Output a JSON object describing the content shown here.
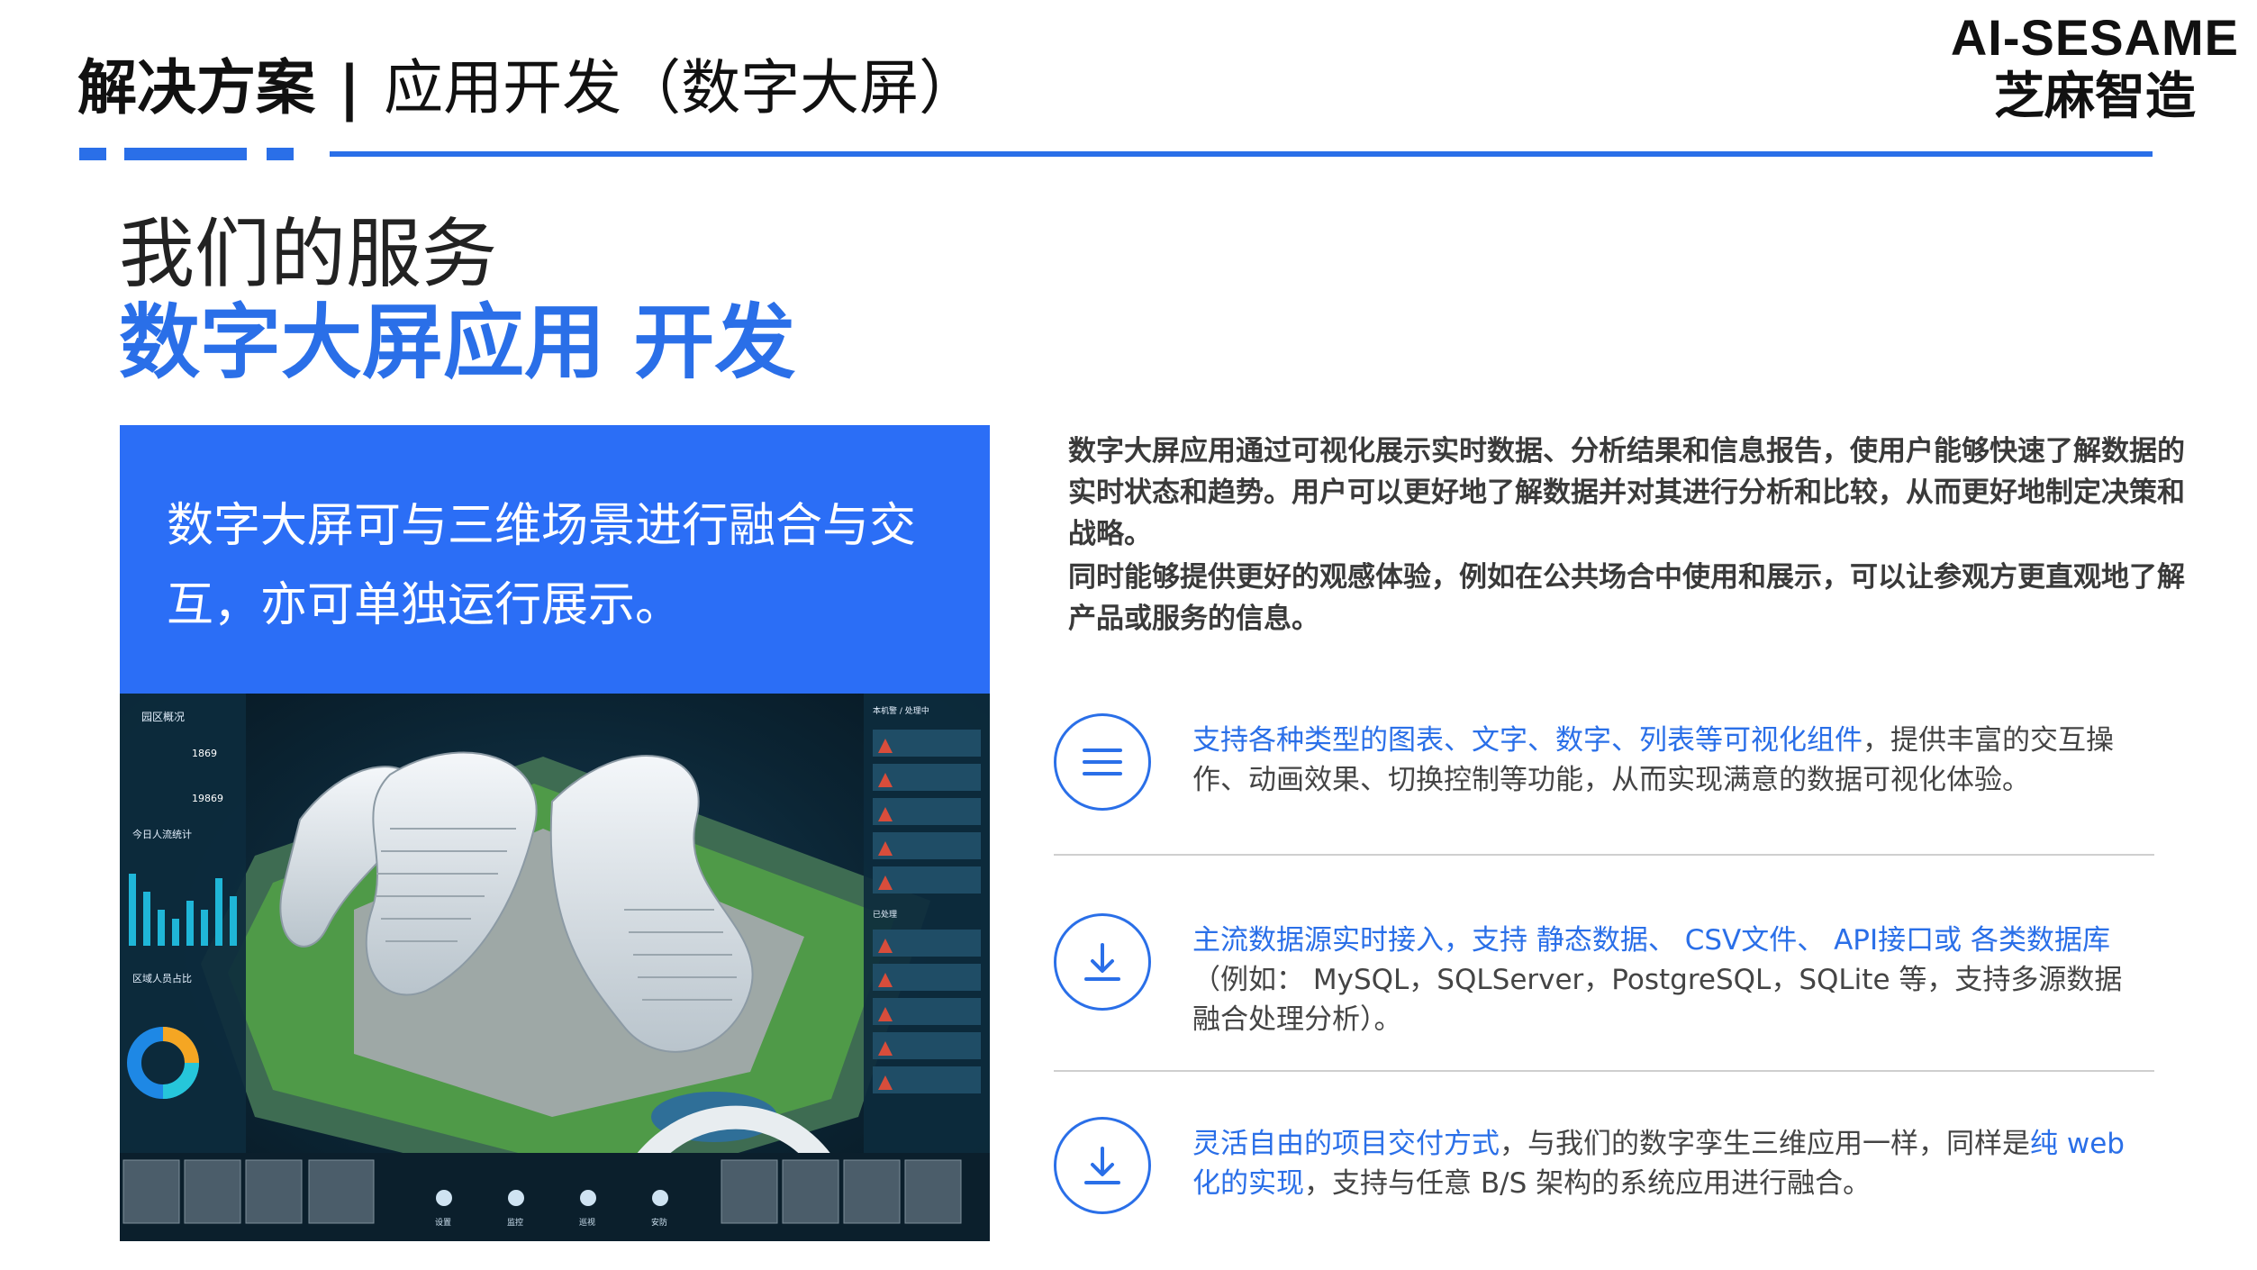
{
  "header": {
    "title_bold": "解决方案",
    "separator": "|",
    "title_rest": "应用开发（数字大屏）",
    "brand_en": "AI-SESAME",
    "brand_cn": "芝麻智造"
  },
  "colors": {
    "accent": "#2a6fe8",
    "box": "#2b6ef6"
  },
  "service": {
    "title": "我们的服务",
    "subtitle": "数字大屏应用 开发"
  },
  "callout": "数字大屏可与三维场景进行融合与交互，亦可单独运行展示。",
  "intro": [
    "数字大屏应用通过可视化展示实时数据、分析结果和信息报告，使用户能够快速了解数据的实时状态和趋势。用户可以更好地了解数据并对其进行分析和比较，从而更好地制定决策和战略。",
    "同时能够提供更好的观感体验，例如在公共场合中使用和展示，可以让参观方更直观地了解产品或服务的信息。"
  ],
  "features": [
    {
      "icon": "menu-icon",
      "highlight": "支持各种类型的图表、文字、数字、列表等可视化组件",
      "text": "，提供丰富的交互操作、动画效果、切换控制等功能，从而实现满意的数据可视化体验。"
    },
    {
      "icon": "download-icon",
      "highlight": "主流数据源实时接入，支持 静态数据、 CSV文件、 API接口或 各类数据库",
      "text": "（例如： MySQL，SQLServer，PostgreSQL，SQLite 等，支持多源数据融合处理分析）。"
    },
    {
      "icon": "download-icon",
      "highlight": "灵活自由的项目交付方式",
      "text": "，与我们的数字孪生三维应用一样，同样是",
      "highlight2": "纯 web 化的实现",
      "text2": "，支持与任意 B/S 架构的系统应用进行融合。"
    }
  ],
  "screenshot": {
    "panel_left_title": "园区概况",
    "stat1": "1869",
    "stat2": "19869",
    "chart_title": "今日人流统计",
    "donut_title": "区域人员占比",
    "panel_right_title": "本机警 / 处理中",
    "panel_right_title2": "已处理",
    "bottom_tools": [
      "设置",
      "监控",
      "巡视",
      "安防"
    ]
  }
}
